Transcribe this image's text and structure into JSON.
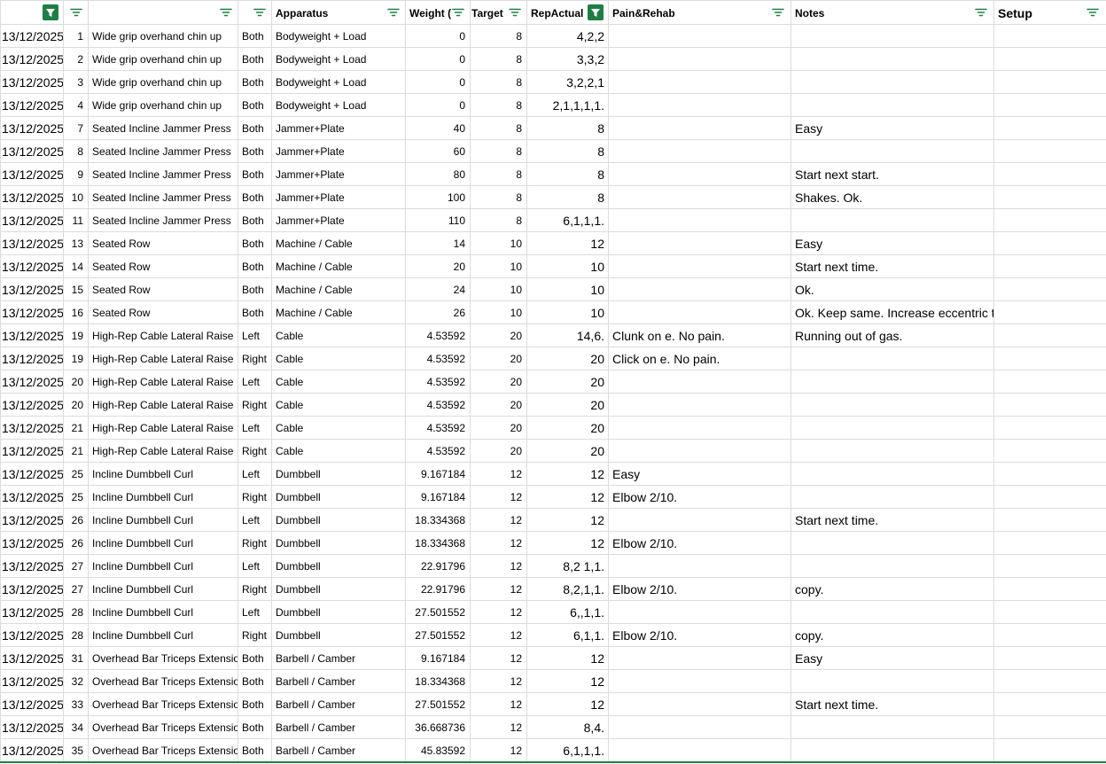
{
  "headers": [
    {
      "label": "",
      "filter_active": true
    },
    {
      "label": "",
      "filter_active": false
    },
    {
      "label": "",
      "filter_active": false
    },
    {
      "label": "",
      "filter_active": false
    },
    {
      "label": "Apparatus",
      "filter_active": false
    },
    {
      "label": "Weight (",
      "filter_active": false
    },
    {
      "label": "Target",
      "filter_active": false
    },
    {
      "label": "RepActual",
      "filter_active": true
    },
    {
      "label": "Pain&Rehab",
      "filter_active": false
    },
    {
      "label": "Notes",
      "filter_active": false
    },
    {
      "label": "Setup",
      "filter_active": false
    }
  ],
  "colors": {
    "filter_green": "#1e7e45",
    "gridline": "#dadce0"
  },
  "rows": [
    [
      "13/12/2025",
      "1",
      "Wide grip overhand chin up",
      "Both",
      "Bodyweight + Load",
      "0",
      "8",
      "4,2,2",
      "",
      ""
    ],
    [
      "13/12/2025",
      "2",
      "Wide grip overhand chin up",
      "Both",
      "Bodyweight + Load",
      "0",
      "8",
      "3,3,2",
      "",
      ""
    ],
    [
      "13/12/2025",
      "3",
      "Wide grip overhand chin up",
      "Both",
      "Bodyweight + Load",
      "0",
      "8",
      "3,2,2,1",
      "",
      ""
    ],
    [
      "13/12/2025",
      "4",
      "Wide grip overhand chin up",
      "Both",
      "Bodyweight + Load",
      "0",
      "8",
      "2,1,1,1,1.",
      "",
      ""
    ],
    [
      "13/12/2025",
      "7",
      "Seated Incline Jammer Press",
      "Both",
      "Jammer+Plate",
      "40",
      "8",
      "8",
      "",
      "Easy"
    ],
    [
      "13/12/2025",
      "8",
      "Seated Incline Jammer Press",
      "Both",
      "Jammer+Plate",
      "60",
      "8",
      "8",
      "",
      ""
    ],
    [
      "13/12/2025",
      "9",
      "Seated Incline Jammer Press",
      "Both",
      "Jammer+Plate",
      "80",
      "8",
      "8",
      "",
      "Start next start."
    ],
    [
      "13/12/2025",
      "10",
      "Seated Incline Jammer Press",
      "Both",
      "Jammer+Plate",
      "100",
      "8",
      "8",
      "",
      "Shakes. Ok."
    ],
    [
      "13/12/2025",
      "11",
      "Seated Incline Jammer Press",
      "Both",
      "Jammer+Plate",
      "110",
      "8",
      "6,1,1,1.",
      "",
      ""
    ],
    [
      "13/12/2025",
      "13",
      "Seated Row",
      "Both",
      "Machine / Cable",
      "14",
      "10",
      "12",
      "",
      "Easy"
    ],
    [
      "13/12/2025",
      "14",
      "Seated Row",
      "Both",
      "Machine / Cable",
      "20",
      "10",
      "10",
      "",
      "Start next time."
    ],
    [
      "13/12/2025",
      "15",
      "Seated Row",
      "Both",
      "Machine / Cable",
      "24",
      "10",
      "10",
      "",
      "Ok."
    ],
    [
      "13/12/2025",
      "16",
      "Seated Row",
      "Both",
      "Machine / Cable",
      "26",
      "10",
      "10",
      "",
      "Ok. Keep same. Increase eccentric t."
    ],
    [
      "13/12/2025",
      "19",
      "High-Rep Cable Lateral Raise",
      "Left",
      "Cable",
      "4.53592",
      "20",
      "14,6.",
      "Clunk on e. No pain.",
      "Running out of gas."
    ],
    [
      "13/12/2025",
      "19",
      "High-Rep Cable Lateral Raise",
      "Right",
      "Cable",
      "4.53592",
      "20",
      "20",
      "Click on e. No pain.",
      ""
    ],
    [
      "13/12/2025",
      "20",
      "High-Rep Cable Lateral Raise",
      "Left",
      "Cable",
      "4.53592",
      "20",
      "20",
      "",
      ""
    ],
    [
      "13/12/2025",
      "20",
      "High-Rep Cable Lateral Raise",
      "Right",
      "Cable",
      "4.53592",
      "20",
      "20",
      "",
      ""
    ],
    [
      "13/12/2025",
      "21",
      "High-Rep Cable Lateral Raise",
      "Left",
      "Cable",
      "4.53592",
      "20",
      "20",
      "",
      ""
    ],
    [
      "13/12/2025",
      "21",
      "High-Rep Cable Lateral Raise",
      "Right",
      "Cable",
      "4.53592",
      "20",
      "20",
      "",
      ""
    ],
    [
      "13/12/2025",
      "25",
      "Incline Dumbbell Curl",
      "Left",
      "Dumbbell",
      "9.167184",
      "12",
      "12",
      "Easy",
      ""
    ],
    [
      "13/12/2025",
      "25",
      "Incline Dumbbell Curl",
      "Right",
      "Dumbbell",
      "9.167184",
      "12",
      "12",
      "Elbow 2/10.",
      ""
    ],
    [
      "13/12/2025",
      "26",
      "Incline Dumbbell Curl",
      "Left",
      "Dumbbell",
      "18.334368",
      "12",
      "12",
      "",
      "Start next time."
    ],
    [
      "13/12/2025",
      "26",
      "Incline Dumbbell Curl",
      "Right",
      "Dumbbell",
      "18.334368",
      "12",
      "12",
      "Elbow 2/10.",
      ""
    ],
    [
      "13/12/2025",
      "27",
      "Incline Dumbbell Curl",
      "Left",
      "Dumbbell",
      "22.91796",
      "12",
      "8,2 1,1.",
      "",
      ""
    ],
    [
      "13/12/2025",
      "27",
      "Incline Dumbbell Curl",
      "Right",
      "Dumbbell",
      "22.91796",
      "12",
      "8,2,1,1.",
      "Elbow 2/10.",
      "copy."
    ],
    [
      "13/12/2025",
      "28",
      "Incline Dumbbell Curl",
      "Left",
      "Dumbbell",
      "27.501552",
      "12",
      "6,,1,1.",
      "",
      ""
    ],
    [
      "13/12/2025",
      "28",
      "Incline Dumbbell Curl",
      "Right",
      "Dumbbell",
      "27.501552",
      "12",
      "6,1,1.",
      "Elbow 2/10.",
      "copy."
    ],
    [
      "13/12/2025",
      "31",
      "Overhead Bar Triceps Extension",
      "Both",
      "Barbell / Camber",
      "9.167184",
      "12",
      "12",
      "",
      "Easy"
    ],
    [
      "13/12/2025",
      "32",
      "Overhead Bar Triceps Extension",
      "Both",
      "Barbell / Camber",
      "18.334368",
      "12",
      "12",
      "",
      ""
    ],
    [
      "13/12/2025",
      "33",
      "Overhead Bar Triceps Extension",
      "Both",
      "Barbell / Camber",
      "27.501552",
      "12",
      "12",
      "",
      "Start next time."
    ],
    [
      "13/12/2025",
      "34",
      "Overhead Bar Triceps Extension",
      "Both",
      "Barbell / Camber",
      "36.668736",
      "12",
      "8,4.",
      "",
      ""
    ],
    [
      "13/12/2025",
      "35",
      "Overhead Bar Triceps Extension",
      "Both",
      "Barbell / Camber",
      "45.83592",
      "12",
      "6,1,1,1.",
      "",
      ""
    ]
  ]
}
